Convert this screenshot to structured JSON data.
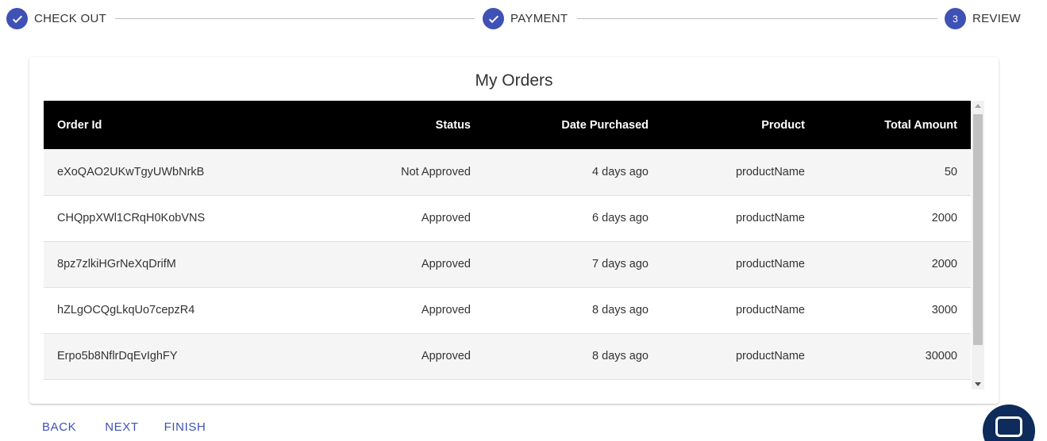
{
  "stepper": {
    "steps": [
      {
        "label": "CHECK OUT",
        "state": "completed",
        "icon": "check-icon"
      },
      {
        "label": "PAYMENT",
        "state": "completed",
        "icon": "check-icon"
      },
      {
        "label": "REVIEW",
        "state": "active",
        "number": "3"
      }
    ],
    "accent_color": "#3f51b5"
  },
  "card": {
    "title": "My Orders"
  },
  "table": {
    "columns": [
      "Order Id",
      "Status",
      "Date Purchased",
      "Product",
      "Total Amount"
    ],
    "rows": [
      {
        "order_id": "eXoQAO2UKwTgyUWbNrkB",
        "status": "Not Approved",
        "date": "4 days ago",
        "product": "productName",
        "total": "50"
      },
      {
        "order_id": "CHQppXWl1CRqH0KobVNS",
        "status": "Approved",
        "date": "6 days ago",
        "product": "productName",
        "total": "2000"
      },
      {
        "order_id": "8pz7zlkiHGrNeXqDrifM",
        "status": "Approved",
        "date": "7 days ago",
        "product": "productName",
        "total": "2000"
      },
      {
        "order_id": "hZLgOCQgLkqUo7cepzR4",
        "status": "Approved",
        "date": "8 days ago",
        "product": "productName",
        "total": "3000"
      },
      {
        "order_id": "Erpo5b8NflrDqEvIghFY",
        "status": "Approved",
        "date": "8 days ago",
        "product": "productName",
        "total": "30000"
      }
    ],
    "header_bg": "#000000"
  },
  "actions": {
    "back": "BACK",
    "next": "NEXT",
    "finish": "FINISH"
  },
  "chat": {
    "icon": "chat-icon",
    "color": "#0d2c5c"
  }
}
